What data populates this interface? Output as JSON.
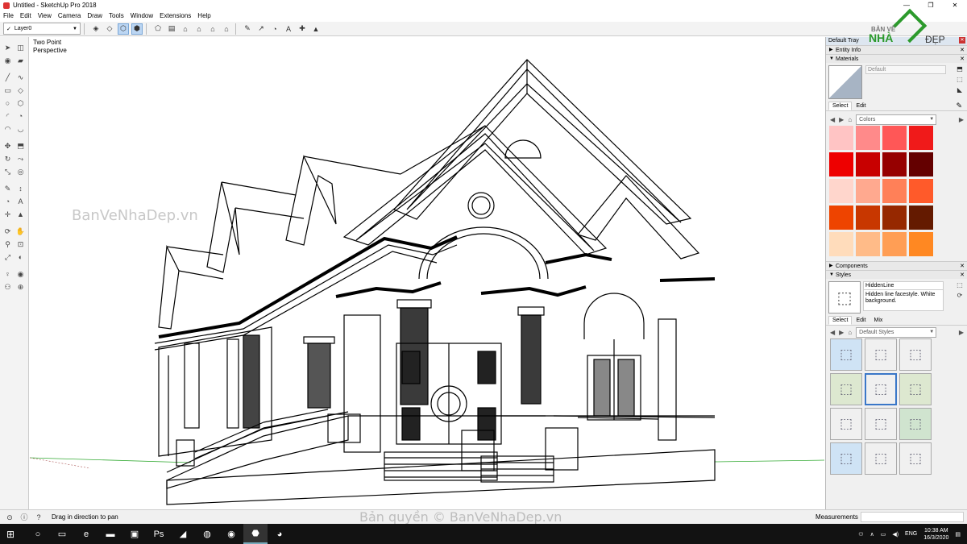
{
  "window": {
    "title": "Untitled - SketchUp Pro 2018",
    "controls": [
      "—",
      "❐",
      "✕"
    ]
  },
  "menu": [
    "File",
    "Edit",
    "View",
    "Camera",
    "Draw",
    "Tools",
    "Window",
    "Extensions",
    "Help"
  ],
  "toolbar": {
    "layer_check": "✓",
    "layer": "Layer0"
  },
  "viewport": {
    "camera_label_1": "Two Point",
    "camera_label_2": "Perspective",
    "watermark": "BanVeNhaDep.vn"
  },
  "logo": {
    "line1": "BẢN VẼ",
    "line2": "NHÀ",
    "line3": "ĐẸP"
  },
  "tray": {
    "title": "Default Tray",
    "entity_info": "Entity Info",
    "materials": {
      "header": "Materials",
      "name": "Default",
      "tabs": [
        "Select",
        "Edit"
      ],
      "collection": "Colors",
      "swatches": [
        "#ffc4c4",
        "#ff8a8a",
        "#ff5757",
        "#f01a1a",
        "#ee0000",
        "#c80000",
        "#960000",
        "#640000",
        "#ffd6cc",
        "#ffa98f",
        "#ff8058",
        "#ff5a2a",
        "#ee4400",
        "#c83700",
        "#962800",
        "#641a00",
        "#ffdcbb",
        "#ffbb88",
        "#ff9e55",
        "#ff8822"
      ]
    },
    "components": "Components",
    "styles": {
      "header": "Styles",
      "name": "HiddenLine",
      "description": "Hidden line facestyle. White background.",
      "tabs": [
        "Select",
        "Edit",
        "Mix"
      ],
      "collection": "Default Styles"
    }
  },
  "status": {
    "hint": "Drag in direction to pan",
    "measurements": "Measurements",
    "copyright": "Bản quyền © BanVeNhaDep.vn"
  },
  "taskbar": {
    "lang": "ENG",
    "time": "10:38 AM",
    "date": "16/3/2020"
  }
}
